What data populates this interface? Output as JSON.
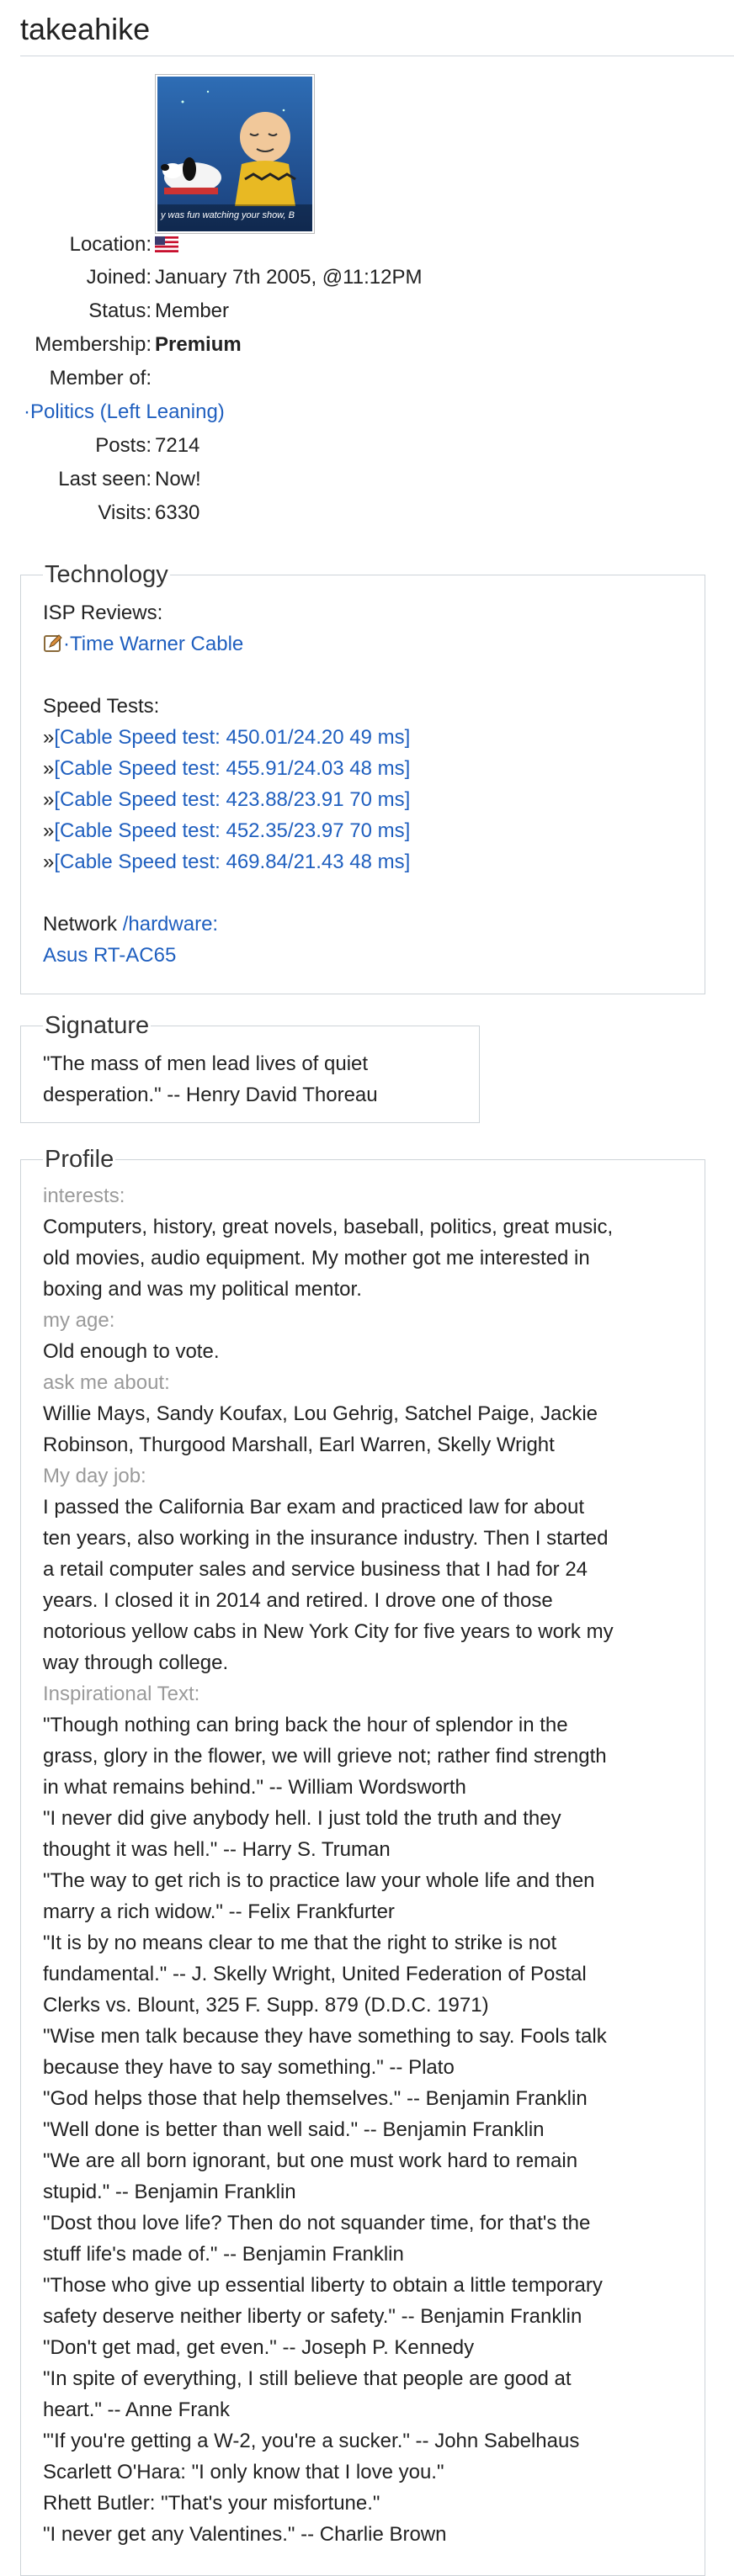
{
  "username": "takeahike",
  "avatar_caption": "y was fun watching your show, B",
  "profile_info": {
    "location_label": "Location:",
    "joined_label": "Joined:",
    "joined_value": "January 7th 2005, @11:12PM",
    "status_label": "Status:",
    "status_value": "Member",
    "membership_label": "Membership:",
    "membership_value": "Premium",
    "member_of_label": "Member of:",
    "member_of_group": "·Politics (Left Leaning)",
    "posts_label": "Posts:",
    "posts_value": "7214",
    "last_seen_label": "Last seen:",
    "last_seen_value": "Now!",
    "visits_label": "Visits:",
    "visits_value": "6330"
  },
  "technology": {
    "legend": "Technology",
    "isp_reviews_label": "ISP Reviews:",
    "isp_review_link": "·Time Warner Cable",
    "speed_tests_label": "Speed Tests:",
    "speed_tests": [
      "[Cable Speed test: 450.01/24.20 49 ms]",
      "[Cable Speed test: 455.91/24.03 48 ms]",
      "[Cable Speed test: 423.88/23.91 70 ms]",
      "[Cable Speed test: 452.35/23.97 70 ms]",
      "[Cable Speed test: 469.84/21.43 48 ms]"
    ],
    "network_label": "Network",
    "hardware_link": "/hardware:",
    "router": "Asus RT-AC65"
  },
  "signature": {
    "legend": "Signature",
    "line1": "\"The mass of men lead lives of quiet",
    "line2": "desperation.\" -- Henry David Thoreau"
  },
  "profile": {
    "legend": "Profile",
    "interests_label": "interests:",
    "interests_lines": [
      "Computers, history, great novels, baseball, politics, great music,",
      "old movies, audio equipment. My mother got me interested in",
      "boxing and was my political mentor."
    ],
    "age_label": "my age:",
    "age_value": "Old enough to vote.",
    "ask_label": "ask me about:",
    "ask_lines": [
      "Willie Mays, Sandy Koufax, Lou Gehrig, Satchel Paige, Jackie",
      "Robinson, Thurgood Marshall, Earl Warren, Skelly Wright"
    ],
    "job_label": "My day job:",
    "job_lines": [
      "I passed the California Bar exam and practiced law for about",
      "ten years, also working in the insurance industry. Then I started",
      "a retail computer sales and service business that I had for 24",
      "years. I closed it in 2014 and retired. I drove one of those",
      "notorious yellow cabs in New York City for five years to work my",
      "way through college."
    ],
    "inspirational_label": "Inspirational Text:",
    "inspirational_lines": [
      "\"Though nothing can bring back the hour of splendor in the",
      "grass, glory in the flower, we will grieve not; rather find strength",
      "in what remains behind.\" -- William Wordsworth",
      "\"I never did give anybody hell. I just told the truth and they",
      "thought it was hell.\" -- Harry S. Truman",
      "\"The way to get rich is to practice law your whole life and then",
      "marry a rich widow.\" -- Felix Frankfurter",
      "\"It is by no means clear to me that the right to strike is not",
      "fundamental.\" -- J. Skelly Wright, United Federation of Postal",
      "Clerks vs. Blount, 325 F. Supp. 879 (D.D.C. 1971)",
      "\"Wise men talk because they have something to say. Fools talk",
      "because they have to say something.\" -- Plato",
      "\"God helps those that help themselves.\" -- Benjamin Franklin",
      "\"Well done is better than well said.\" -- Benjamin Franklin",
      "\"We are all born ignorant, but one must work hard to remain",
      "stupid.\" -- Benjamin Franklin",
      "\"Dost thou love life? Then do not squander time, for that's the",
      "stuff life's made of.\" -- Benjamin Franklin",
      "\"Those who give up essential liberty to obtain a little temporary",
      "safety deserve neither liberty or safety.\" -- Benjamin Franklin",
      "\"Don't get mad, get even.\" -- Joseph P. Kennedy",
      "\"In spite of everything, I still believe that people are good at",
      "heart.\" -- Anne Frank",
      "\"'If you're getting a W-2, you're a sucker.\" -- John Sabelhaus",
      "Scarlett O'Hara: \"I only know that I love you.\"",
      "Rhett Butler: \"That's your misfortune.\"",
      "\"I never get any Valentines.\" -- Charlie Brown"
    ]
  },
  "colors": {
    "link": "#1f5fbf",
    "muted_label": "#9a9a9a",
    "border": "#cdd3d8"
  }
}
